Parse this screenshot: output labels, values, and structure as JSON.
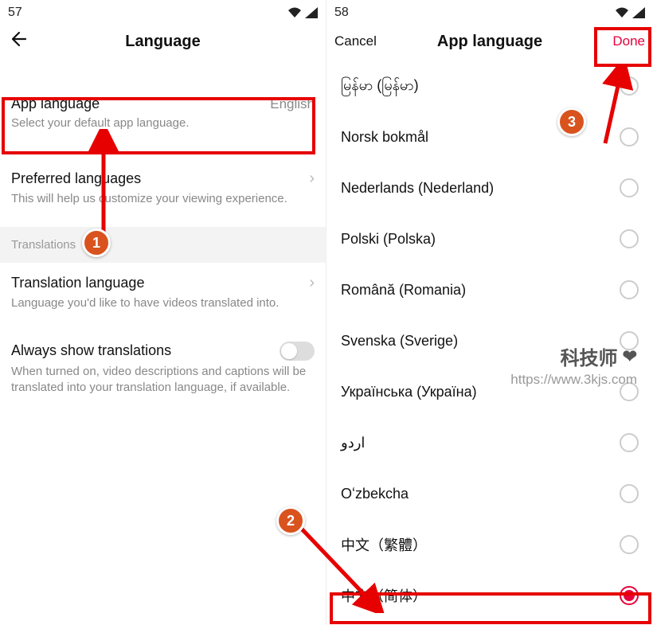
{
  "left": {
    "status_time": "57",
    "title": "Language",
    "app_lang": {
      "label": "App language",
      "value": "English",
      "sub": "Select your default app language."
    },
    "pref_lang": {
      "label": "Preferred languages",
      "sub": "This will help us customize your viewing experience."
    },
    "translations_header": "Translations",
    "trans_lang": {
      "label": "Translation language",
      "sub": "Language you'd like to have videos translated into."
    },
    "always_show": {
      "label": "Always show translations",
      "sub": "When turned on, video descriptions and captions will be translated into your translation language, if available."
    }
  },
  "right": {
    "status_time": "58",
    "cancel": "Cancel",
    "title": "App language",
    "done": "Done",
    "languages": [
      "မြန်မာ (မြန်မာ)",
      "Norsk bokmål",
      "Nederlands (Nederland)",
      "Polski (Polska)",
      "Română (Romania)",
      "Svenska (Sverige)",
      "Українська (Україна)",
      "اردو",
      "Oʻzbekcha",
      "中文（繁體）",
      "中文（简体）"
    ],
    "selected_index": 10
  },
  "annotations": {
    "badge1": "1",
    "badge2": "2",
    "badge3": "3"
  },
  "watermark": {
    "line1": "科技师",
    "line2": "https://www.3kjs.com"
  }
}
